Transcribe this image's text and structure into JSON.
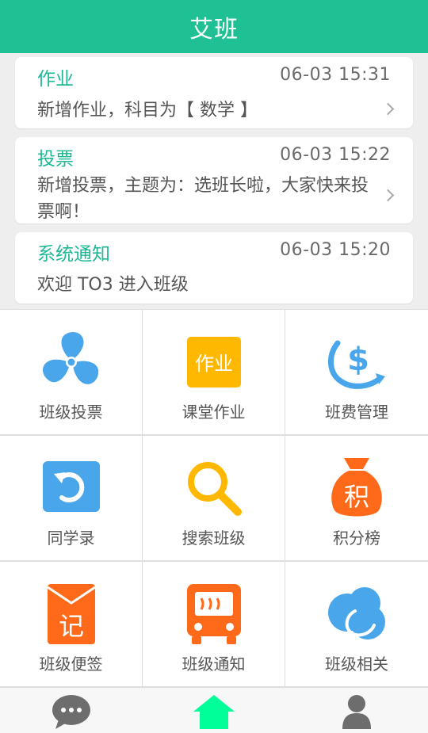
{
  "header": {
    "title": "艾班"
  },
  "notifications": [
    {
      "title": "作业",
      "time": "06-03 15:31",
      "text": "新增作业，科目为【 数学 】"
    },
    {
      "title": "投票",
      "time": "06-03 15:22",
      "text": "新增投票，主题为：选班长啦，大家快来投票啊！"
    },
    {
      "title": "系统通知",
      "time": "06-03 15:20",
      "text": "欢迎 TO3 进入班级"
    }
  ],
  "grid": {
    "items": [
      {
        "label": "班级投票",
        "icon": "fan-icon"
      },
      {
        "label": "课堂作业",
        "icon": "homework-icon",
        "icon_text": "作业"
      },
      {
        "label": "班费管理",
        "icon": "dollar-coin-icon",
        "icon_text": "$"
      },
      {
        "label": "同学录",
        "icon": "refresh-icon"
      },
      {
        "label": "搜索班级",
        "icon": "search-icon"
      },
      {
        "label": "积分榜",
        "icon": "money-bag-icon",
        "icon_text": "积"
      },
      {
        "label": "班级便签",
        "icon": "red-envelope-icon",
        "icon_text": "记"
      },
      {
        "label": "班级通知",
        "icon": "bus-icon"
      },
      {
        "label": "班级相关",
        "icon": "cloud-icon"
      }
    ]
  },
  "bottom_nav": {
    "items": [
      {
        "icon": "chat-icon",
        "active": false
      },
      {
        "icon": "home-icon",
        "active": true
      },
      {
        "icon": "user-icon",
        "active": false
      }
    ]
  },
  "colors": {
    "brand": "#1fc094",
    "active_nav": "#00ff99",
    "inactive_nav": "#6d6d6d",
    "blue": "#4aa6ea",
    "orange": "#ff6a1a",
    "yellow": "#ffb800"
  }
}
